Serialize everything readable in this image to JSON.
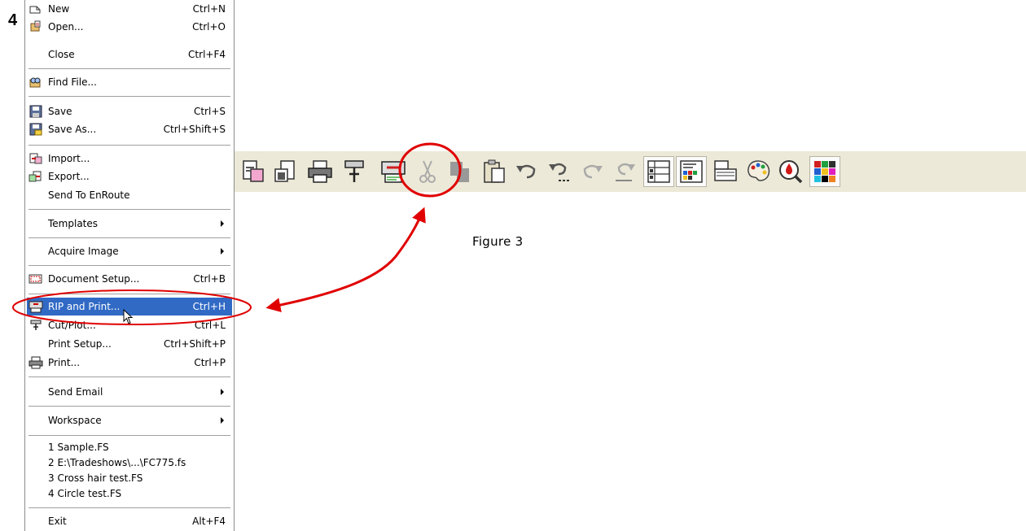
{
  "step_number": "4",
  "figure_caption": "Figure 3",
  "colors": {
    "highlight": "#316ac5",
    "annotation": "#e00000",
    "toolbar_bg": "#ece9d8"
  },
  "file_menu": {
    "items": [
      {
        "label": "New",
        "shortcut": "Ctrl+N",
        "icon": "new-document-icon"
      },
      {
        "label": "Open...",
        "shortcut": "Ctrl+O",
        "icon": "open-folder-icon"
      },
      {
        "label": "Close",
        "shortcut": "Ctrl+F4",
        "icon": ""
      },
      {
        "label": "Find File...",
        "shortcut": "",
        "icon": "find-file-icon"
      },
      {
        "label": "Save",
        "shortcut": "Ctrl+S",
        "icon": "save-icon"
      },
      {
        "label": "Save As...",
        "shortcut": "Ctrl+Shift+S",
        "icon": "save-as-icon"
      },
      {
        "label": "Import...",
        "shortcut": "",
        "icon": "import-icon"
      },
      {
        "label": "Export...",
        "shortcut": "",
        "icon": "export-icon"
      },
      {
        "label": "Send To EnRoute",
        "shortcut": "",
        "icon": ""
      },
      {
        "label": "Templates",
        "shortcut": "",
        "icon": "",
        "submenu": true
      },
      {
        "label": "Acquire Image",
        "shortcut": "",
        "icon": "",
        "submenu": true
      },
      {
        "label": "Document Setup...",
        "shortcut": "Ctrl+B",
        "icon": "document-setup-icon"
      },
      {
        "label": "RIP and Print...",
        "shortcut": "Ctrl+H",
        "icon": "rip-print-icon",
        "highlighted": true
      },
      {
        "label": "Cut/Plot...",
        "shortcut": "Ctrl+L",
        "icon": "cut-plot-icon"
      },
      {
        "label": "Print Setup...",
        "shortcut": "Ctrl+Shift+P",
        "icon": ""
      },
      {
        "label": "Print...",
        "shortcut": "Ctrl+P",
        "icon": "printer-icon"
      },
      {
        "label": "Send Email",
        "shortcut": "",
        "icon": "",
        "submenu": true
      },
      {
        "label": "Workspace",
        "shortcut": "",
        "icon": "",
        "submenu": true
      },
      {
        "label": "1 Sample.FS",
        "shortcut": "",
        "icon": ""
      },
      {
        "label": "2 E:\\Tradeshows\\...\\FC775.fs",
        "shortcut": "",
        "icon": ""
      },
      {
        "label": "3 Cross hair test.FS",
        "shortcut": "",
        "icon": ""
      },
      {
        "label": "4 Circle test.FS",
        "shortcut": "",
        "icon": ""
      },
      {
        "label": "Exit",
        "shortcut": "Alt+F4",
        "icon": ""
      }
    ]
  },
  "toolbar": {
    "buttons": [
      {
        "icon": "import-icon"
      },
      {
        "icon": "export-icon"
      },
      {
        "icon": "printer-icon"
      },
      {
        "icon": "cut-plot-icon"
      },
      {
        "icon": "rip-print-icon",
        "annotated": true
      },
      {
        "icon": "cut-icon",
        "disabled": true
      },
      {
        "icon": "copy-icon",
        "disabled": true
      },
      {
        "icon": "paste-icon"
      },
      {
        "icon": "undo-icon"
      },
      {
        "icon": "undo-multiple-icon"
      },
      {
        "icon": "redo-icon"
      },
      {
        "icon": "redo-multiple-icon"
      },
      {
        "icon": "object-properties-icon",
        "pressed": true
      },
      {
        "icon": "color-palette-window-icon",
        "pressed": true
      },
      {
        "icon": "layers-icon"
      },
      {
        "icon": "artist-palette-icon"
      },
      {
        "icon": "color-picker-icon"
      },
      {
        "icon": "color-swatches-icon",
        "pressed": true
      }
    ]
  }
}
